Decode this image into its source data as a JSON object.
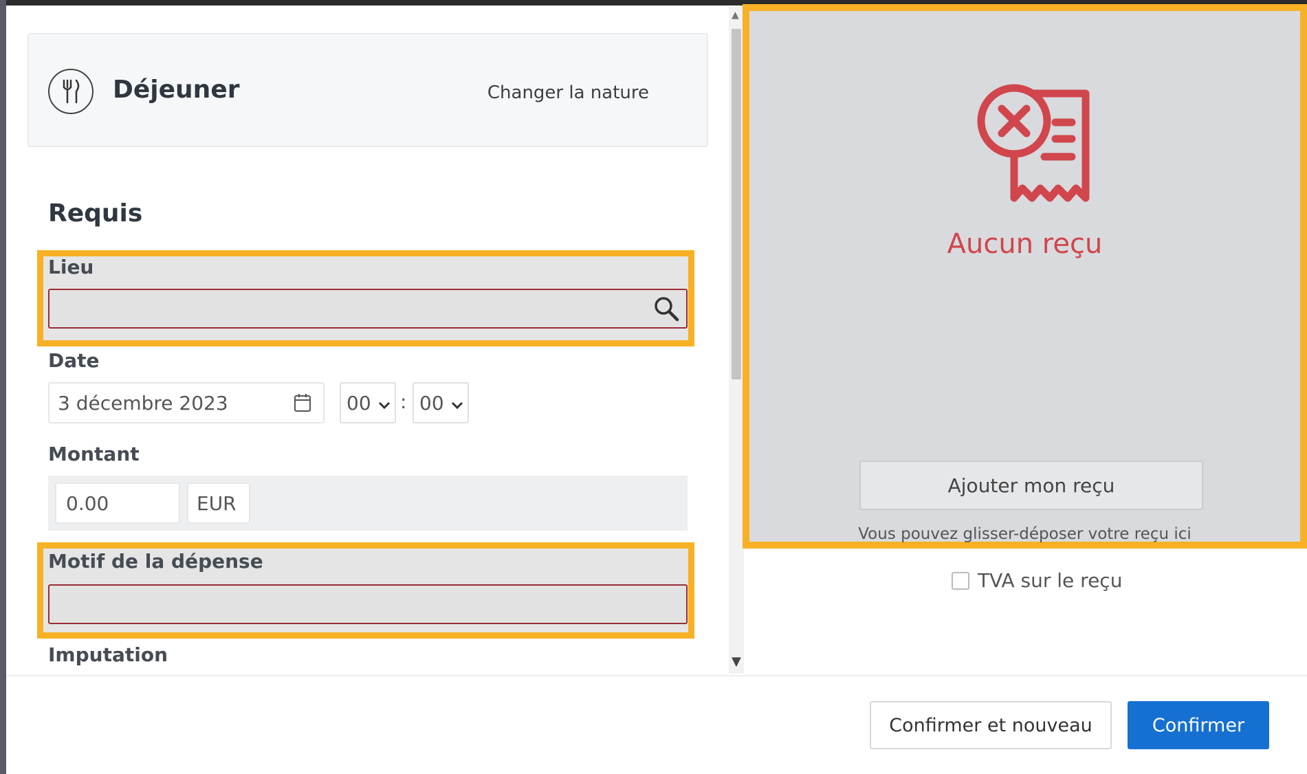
{
  "header": {
    "nature_title": "Déjeuner",
    "nature_icon": "fork-knife-icon",
    "change_nature_label": "Changer la nature"
  },
  "form": {
    "section_title": "Requis",
    "lieu": {
      "label": "Lieu",
      "value": "",
      "icon": "search-icon"
    },
    "date": {
      "label": "Date",
      "value": "3 décembre 2023",
      "icon": "calendar-icon",
      "hour": "00",
      "minute": "00",
      "separator": ":"
    },
    "montant": {
      "label": "Montant",
      "value": "0.00",
      "currency": "EUR"
    },
    "motif": {
      "label": "Motif de la dépense",
      "value": ""
    },
    "imputation": {
      "label": "Imputation"
    }
  },
  "receipt": {
    "icon": "no-receipt-icon",
    "status_text": "Aucun reçu",
    "add_button_label": "Ajouter mon reçu",
    "drag_hint": "Vous pouvez glisser-déposer votre reçu ici",
    "tva_label": "TVA sur le reçu",
    "tva_checked": false
  },
  "footer": {
    "confirm_new_label": "Confirmer et nouveau",
    "confirm_label": "Confirmer"
  },
  "colors": {
    "highlight": "#f8b124",
    "error_border": "#9b2d35",
    "receipt_red": "#d0464c",
    "primary_button": "#1670d1"
  }
}
